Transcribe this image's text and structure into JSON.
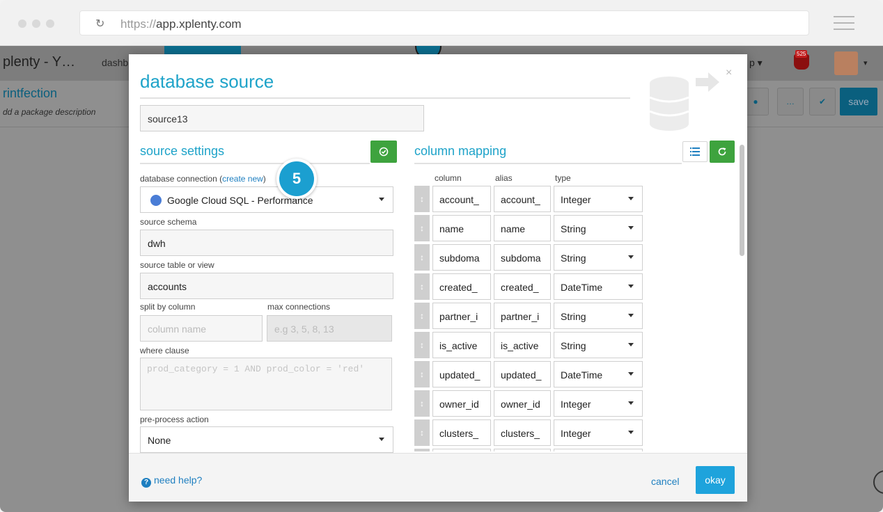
{
  "browser": {
    "url_protocol": "https://",
    "url_host": "app.xplenty.com"
  },
  "app": {
    "title": "plenty - Y…",
    "nav_dashboard": "dashb",
    "help_menu": "p",
    "notification_count": "525",
    "package_name": "rintfection",
    "package_description": "dd a package description",
    "more_label": "…",
    "save_label": "save"
  },
  "modal": {
    "title": "database source",
    "component_name": "source13",
    "source_settings": {
      "title": "source settings",
      "connection_label": "database connection (",
      "create_new_link": "create new",
      "connection_label_end": ")",
      "connection_value": "Google Cloud SQL - Performance",
      "schema_label": "source schema",
      "schema_value": "dwh",
      "table_label": "source table or view",
      "table_value": "accounts",
      "split_label": "split by column",
      "split_placeholder": "column name",
      "max_conn_label": "max connections",
      "max_conn_placeholder": "e.g 3, 5, 8, 13",
      "where_label": "where clause",
      "where_placeholder": "prod_category = 1 AND prod_color = 'red'",
      "preprocess_label": "pre-process action",
      "preprocess_value": "None"
    },
    "column_mapping": {
      "title": "column mapping",
      "headers": [
        "column",
        "alias",
        "type"
      ],
      "rows": [
        {
          "column": "account_",
          "alias": "account_",
          "type": "Integer"
        },
        {
          "column": "name",
          "alias": "name",
          "type": "String"
        },
        {
          "column": "subdoma",
          "alias": "subdoma",
          "type": "String"
        },
        {
          "column": "created_",
          "alias": "created_",
          "type": "DateTime"
        },
        {
          "column": "partner_i",
          "alias": "partner_i",
          "type": "String"
        },
        {
          "column": "is_active",
          "alias": "is_active",
          "type": "String"
        },
        {
          "column": "updated_",
          "alias": "updated_",
          "type": "DateTime"
        },
        {
          "column": "owner_id",
          "alias": "owner_id",
          "type": "Integer"
        },
        {
          "column": "clusters_",
          "alias": "clusters_",
          "type": "Integer"
        }
      ]
    },
    "step_badge": "5",
    "footer": {
      "need_help": "need help?",
      "cancel": "cancel",
      "okay": "okay"
    }
  },
  "colors": {
    "accent": "#1ea3c9",
    "green": "#3ea33e",
    "okay_button": "#1ea3dc"
  }
}
